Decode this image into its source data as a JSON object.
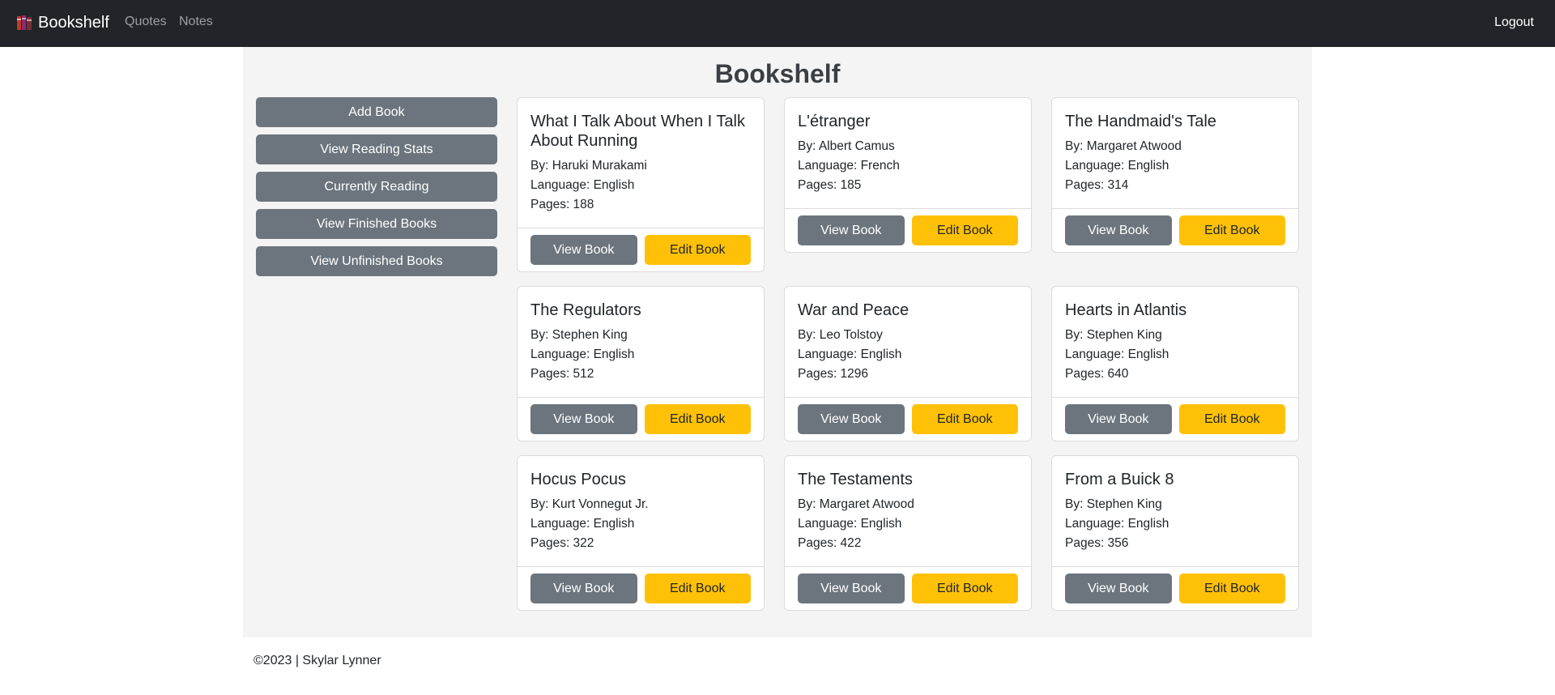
{
  "navbar": {
    "brand": "Bookshelf",
    "brand_icon": "books-icon",
    "links": [
      "Quotes",
      "Notes"
    ],
    "logout": "Logout"
  },
  "page": {
    "title": "Bookshelf"
  },
  "sidebar": {
    "buttons": [
      "Add Book",
      "View Reading Stats",
      "Currently Reading",
      "View Finished Books",
      "View Unfinished Books"
    ]
  },
  "books": [
    {
      "title": "What I Talk About When I Talk About Running",
      "author": "By: Haruki Murakami",
      "language": "Language: English",
      "pages": "Pages: 188",
      "view": "View Book",
      "edit": "Edit Book"
    },
    {
      "title": "L'étranger",
      "author": "By: Albert Camus",
      "language": "Language: French",
      "pages": "Pages: 185",
      "view": "View Book",
      "edit": "Edit Book"
    },
    {
      "title": "The Handmaid's Tale",
      "author": "By: Margaret Atwood",
      "language": "Language: English",
      "pages": "Pages: 314",
      "view": "View Book",
      "edit": "Edit Book"
    },
    {
      "title": "The Regulators",
      "author": "By: Stephen King",
      "language": "Language: English",
      "pages": "Pages: 512",
      "view": "View Book",
      "edit": "Edit Book"
    },
    {
      "title": "War and Peace",
      "author": "By: Leo Tolstoy",
      "language": "Language: English",
      "pages": "Pages: 1296",
      "view": "View Book",
      "edit": "Edit Book"
    },
    {
      "title": "Hearts in Atlantis",
      "author": "By: Stephen King",
      "language": "Language: English",
      "pages": "Pages: 640",
      "view": "View Book",
      "edit": "Edit Book"
    },
    {
      "title": "Hocus Pocus",
      "author": "By: Kurt Vonnegut Jr.",
      "language": "Language: English",
      "pages": "Pages: 322",
      "view": "View Book",
      "edit": "Edit Book"
    },
    {
      "title": "The Testaments",
      "author": "By: Margaret Atwood",
      "language": "Language: English",
      "pages": "Pages: 422",
      "view": "View Book",
      "edit": "Edit Book"
    },
    {
      "title": "From a Buick 8",
      "author": "By: Stephen King",
      "language": "Language: English",
      "pages": "Pages: 356",
      "view": "View Book",
      "edit": "Edit Book"
    }
  ],
  "footer": {
    "text": "©2023 | Skylar Lynner"
  },
  "colors": {
    "navbar": "#212529",
    "secondary": "#6c757d",
    "warning": "#ffc107",
    "container": "#f4f4f4"
  }
}
